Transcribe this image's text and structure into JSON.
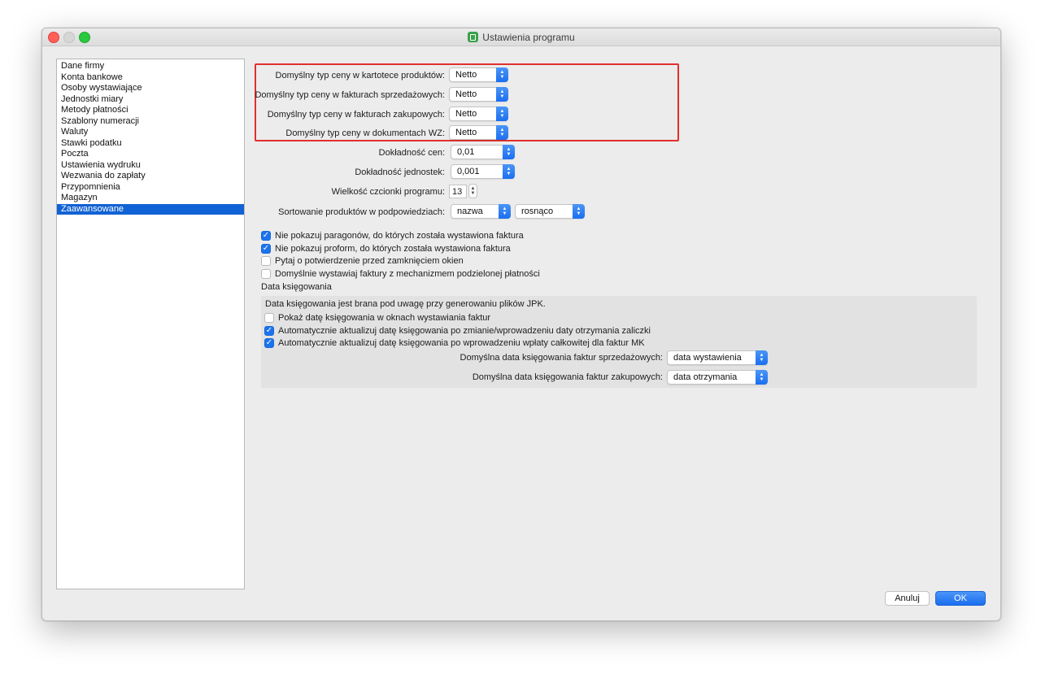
{
  "window": {
    "title": "Ustawienia programu"
  },
  "sidebar": {
    "items": [
      {
        "label": "Dane firmy"
      },
      {
        "label": "Konta bankowe"
      },
      {
        "label": "Osoby wystawiające"
      },
      {
        "label": "Jednostki miary"
      },
      {
        "label": "Metody płatności"
      },
      {
        "label": "Szablony numeracji"
      },
      {
        "label": "Waluty"
      },
      {
        "label": "Stawki podatku"
      },
      {
        "label": "Poczta"
      },
      {
        "label": "Ustawienia wydruku"
      },
      {
        "label": "Wezwania do zapłaty"
      },
      {
        "label": "Przypomnienia"
      },
      {
        "label": "Magazyn"
      },
      {
        "label": "Zaawansowane",
        "selected": true
      }
    ]
  },
  "settings": {
    "price_products": {
      "label": "Domyślny typ ceny w kartotece produktów:",
      "value": "Netto"
    },
    "price_sales": {
      "label": "Domyślny typ ceny w fakturach sprzedażowych:",
      "value": "Netto"
    },
    "price_purchases": {
      "label": "Domyślny typ ceny w fakturach zakupowych:",
      "value": "Netto"
    },
    "price_wz": {
      "label": "Domyślny typ ceny w dokumentach WZ:",
      "value": "Netto"
    },
    "price_precision": {
      "label": "Dokładność cen:",
      "value": "0,01"
    },
    "unit_precision": {
      "label": "Dokładność jednostek:",
      "value": "0,001"
    },
    "font_size": {
      "label": "Wielkość czcionki programu:",
      "value": "13"
    },
    "sorting": {
      "label": "Sortowanie produktów w podpowiedziach:",
      "field": "nazwa",
      "order": "rosnąco"
    }
  },
  "checkboxes": [
    {
      "label": "Nie pokazuj paragonów, do których została wystawiona faktura",
      "checked": true
    },
    {
      "label": "Nie pokazuj proform, do których została wystawiona faktura",
      "checked": true
    },
    {
      "label": "Pytaj o potwierdzenie przed zamknięciem okien",
      "checked": false
    },
    {
      "label": "Domyślnie wystawiaj faktury z mechanizmem podzielonej płatności",
      "checked": false
    }
  ],
  "booking": {
    "title": "Data księgowania",
    "description": "Data księgowania jest brana pod uwagę przy generowaniu plików JPK.",
    "checkboxes": [
      {
        "label": "Pokaż datę księgowania w oknach wystawiania faktur",
        "checked": false
      },
      {
        "label": "Automatycznie aktualizuj datę księgowania po zmianie/wprowadzeniu daty otrzymania zaliczki",
        "checked": true
      },
      {
        "label": "Automatycznie aktualizuj datę księgowania po wprowadzeniu wpłaty całkowitej dla faktur MK",
        "checked": true
      }
    ],
    "sales_date": {
      "label": "Domyślna data księgowania faktur sprzedażowych:",
      "value": "data wystawienia"
    },
    "purchase_date": {
      "label": "Domyślna data księgowania faktur zakupowych:",
      "value": "data otrzymania"
    }
  },
  "buttons": {
    "cancel": "Anuluj",
    "ok": "OK"
  },
  "icons": {
    "check": "✓",
    "arrow_up": "▲",
    "arrow_down": "▼"
  }
}
